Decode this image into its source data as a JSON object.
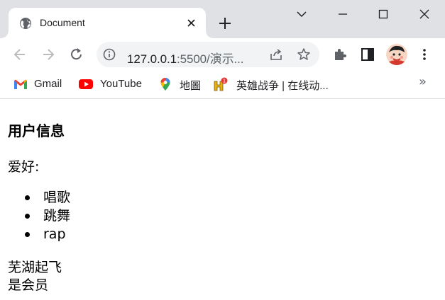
{
  "browser": {
    "tab": {
      "title": "Document",
      "favicon": "globe-icon"
    },
    "window_controls": [
      "chevron-down-icon",
      "minimize-icon",
      "maximize-icon",
      "close-icon"
    ],
    "address_bar": {
      "host": "127.0.0.1",
      "path": ":5500/演示..."
    },
    "bookmarks": [
      {
        "label": "Gmail",
        "icon": "gmail-icon"
      },
      {
        "label": "YouTube",
        "icon": "youtube-icon"
      },
      {
        "label": "地圖",
        "icon": "maps-icon"
      },
      {
        "label": "英雄战争 | 在线动...",
        "icon": "game-icon",
        "badge": "1"
      }
    ],
    "more_bookmarks": "»"
  },
  "page": {
    "heading": "用户信息",
    "hobby_label": "爱好:",
    "hobbies": [
      "唱歌",
      "跳舞",
      "rap"
    ],
    "city": "芜湖起飞",
    "member_status": "是会员"
  },
  "colors": {
    "tabstrip_bg": "#dfe1e5",
    "omnibox_bg": "#f1f3f4",
    "icon_gray": "#5f6368",
    "youtube_red": "#ff0000",
    "gmail_red": "#ea4335"
  }
}
